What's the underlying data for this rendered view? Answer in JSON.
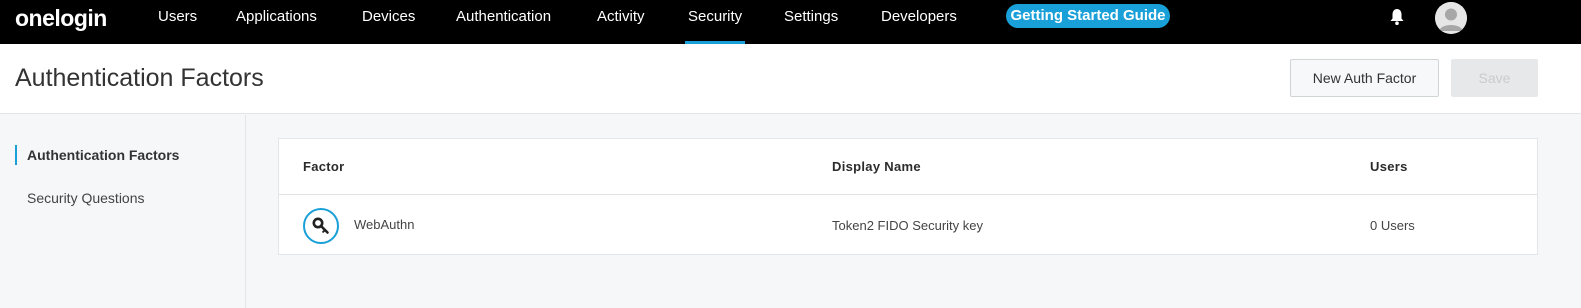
{
  "nav": {
    "logo": "onelogin",
    "items": [
      {
        "label": "Users",
        "name": "nav-users"
      },
      {
        "label": "Applications",
        "name": "nav-applications"
      },
      {
        "label": "Devices",
        "name": "nav-devices"
      },
      {
        "label": "Authentication",
        "name": "nav-authentication"
      },
      {
        "label": "Activity",
        "name": "nav-activity"
      },
      {
        "label": "Security",
        "name": "nav-security",
        "active": true
      },
      {
        "label": "Settings",
        "name": "nav-settings"
      },
      {
        "label": "Developers",
        "name": "nav-developers"
      }
    ],
    "guide_button": "Getting Started Guide",
    "icons": {
      "bell": "bell-icon",
      "avatar": "user-avatar-icon"
    }
  },
  "header": {
    "title": "Authentication Factors",
    "new_button": "New Auth Factor",
    "save_button": "Save"
  },
  "sidebar": {
    "items": [
      {
        "label": "Authentication Factors",
        "active": true
      },
      {
        "label": "Security Questions",
        "active": false
      }
    ]
  },
  "table": {
    "columns": [
      "Factor",
      "Display Name",
      "Users"
    ],
    "rows": [
      {
        "factor": "WebAuthn",
        "display_name": "Token2 FIDO Security key",
        "users": "0 Users",
        "icon": "key-icon"
      }
    ]
  },
  "colors": {
    "accent": "#1aa0d8",
    "nav_bg": "#000000",
    "page_bg": "#f5f7f8"
  }
}
